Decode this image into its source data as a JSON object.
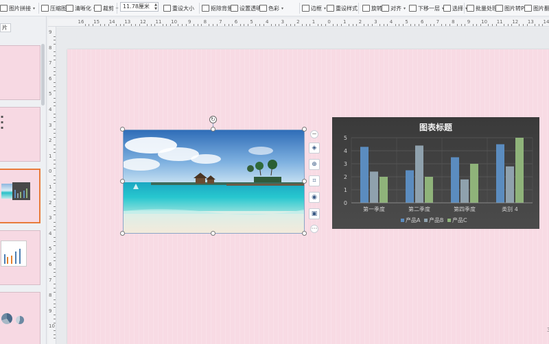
{
  "toolbar": {
    "items": [
      {
        "label": "图片拼接",
        "icon": "image-merge-icon",
        "dropdown": true
      },
      {
        "label": "压缩图片",
        "icon": "compress-image-icon",
        "dropdown": false
      },
      {
        "label": "清晰化",
        "icon": "sharpen-icon",
        "dropdown": true
      },
      {
        "label": "裁剪",
        "icon": "crop-icon",
        "dropdown": true
      },
      {
        "label": "重设大小",
        "icon": "reset-size-icon",
        "dropdown": false
      },
      {
        "label": "抠除背景",
        "icon": "remove-background-icon",
        "dropdown": true
      },
      {
        "label": "设置透明色",
        "icon": "transparent-color-icon",
        "dropdown": false
      },
      {
        "label": "色彩",
        "icon": "color-icon",
        "dropdown": true
      },
      {
        "label": "边框",
        "icon": "border-icon",
        "dropdown": true
      },
      {
        "label": "重设样式",
        "icon": "reset-style-icon",
        "dropdown": false
      },
      {
        "label": "旋转",
        "icon": "rotate-icon",
        "dropdown": true
      },
      {
        "label": "对齐",
        "icon": "align-icon",
        "dropdown": true
      },
      {
        "label": "下移一层",
        "icon": "send-backward-icon",
        "dropdown": true
      },
      {
        "label": "选择",
        "icon": "select-icon",
        "dropdown": true
      },
      {
        "label": "批量处理",
        "icon": "batch-process-icon",
        "dropdown": true
      },
      {
        "label": "图片转PDF",
        "icon": "image-to-pdf-icon",
        "dropdown": false
      },
      {
        "label": "图片翻",
        "icon": "image-translate-icon",
        "dropdown": false
      }
    ],
    "width_value": "11.78厘米"
  },
  "left_panel": {
    "tab_label": "片",
    "slide_count": 6,
    "active_slide": 3
  },
  "slide": {
    "page_number": "3",
    "photo_alt": "tropical beach with overwater bungalows and turquoise sea"
  },
  "float_tools": [
    {
      "name": "collapse-icon",
      "glyph": "−"
    },
    {
      "name": "layers-icon",
      "glyph": "◈"
    },
    {
      "name": "zoom-icon",
      "glyph": "⊕"
    },
    {
      "name": "crop-icon",
      "glyph": "⌗"
    },
    {
      "name": "idea-icon",
      "glyph": "◉"
    },
    {
      "name": "image-tool-icon",
      "glyph": "▣"
    },
    {
      "name": "more-icon",
      "glyph": "⋯"
    }
  ],
  "chart_data": {
    "type": "bar",
    "title": "图表标题",
    "categories": [
      "第一季度",
      "第二季度",
      "第四季度",
      "类别 4"
    ],
    "series": [
      {
        "name": "产品A",
        "color": "#5b8cbf",
        "values": [
          4.3,
          2.5,
          3.5,
          4.5
        ]
      },
      {
        "name": "产品B",
        "color": "#8fa1ad",
        "values": [
          2.4,
          4.4,
          1.8,
          2.8
        ]
      },
      {
        "name": "产品C",
        "color": "#8fb37a",
        "values": [
          2.0,
          2.0,
          3.0,
          5.0
        ]
      }
    ],
    "ylim": [
      0,
      5
    ],
    "yticks": [
      0,
      1,
      2,
      3,
      4,
      5
    ],
    "legend_position": "bottom",
    "grid": true
  }
}
